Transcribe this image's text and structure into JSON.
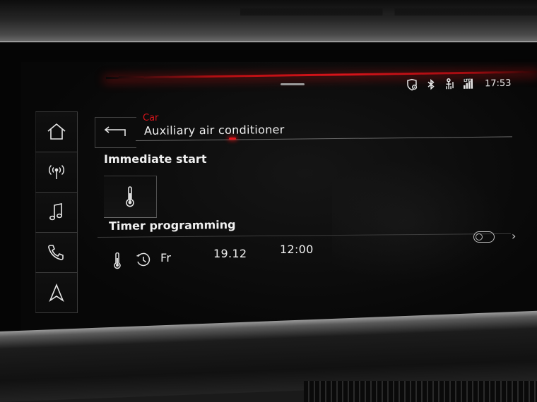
{
  "status_bar": {
    "icons": [
      "location-shield-icon",
      "bluetooth-icon",
      "person-seat-icon",
      "lte-signal-icon"
    ],
    "time": "17:53"
  },
  "nav": {
    "items": [
      {
        "name": "home",
        "icon": "home-icon"
      },
      {
        "name": "radio",
        "icon": "radio-antenna-icon"
      },
      {
        "name": "media",
        "icon": "music-note-icon"
      },
      {
        "name": "phone",
        "icon": "phone-icon"
      },
      {
        "name": "navigation",
        "icon": "navigation-arrow-icon"
      }
    ]
  },
  "header": {
    "breadcrumb": "Car",
    "title": "Auxiliary air conditioner",
    "back_icon": "back-arrow-icon"
  },
  "immediate_start": {
    "title": "Immediate start",
    "tile_icon": "thermometer-icon"
  },
  "timer": {
    "title": "Timer programming",
    "day": "Fr",
    "date": "19.12",
    "time": "12:00",
    "enabled": false,
    "icons": [
      "thermometer-icon",
      "clock-icon",
      "chevron-right-icon"
    ]
  },
  "colors": {
    "accent_red": "#d6141c",
    "text": "#f0f0f0",
    "background": "#070707"
  }
}
